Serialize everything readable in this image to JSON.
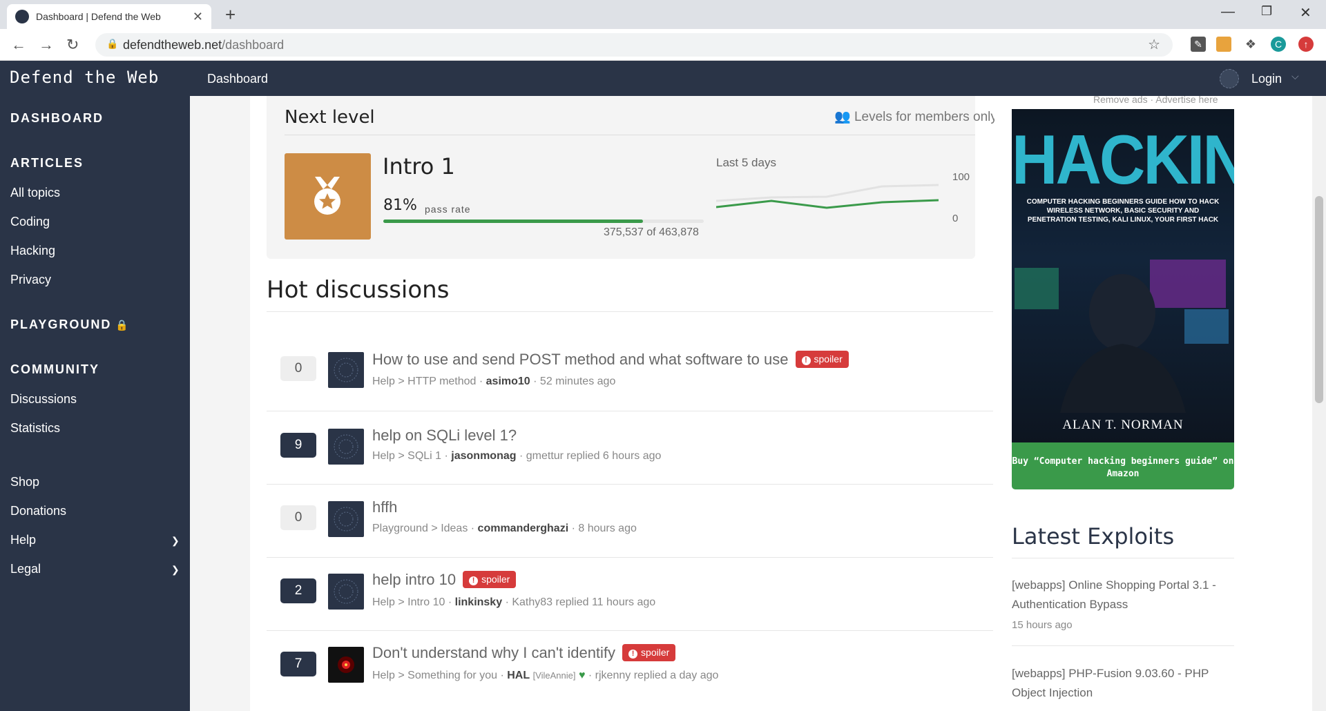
{
  "browser": {
    "tab_title": "Dashboard | Defend the Web",
    "url_host": "defendtheweb.net",
    "url_path": "/dashboard",
    "profile_initial": "C"
  },
  "header": {
    "logo": "Defend the Web",
    "nav_dashboard": "Dashboard",
    "login": "Login"
  },
  "sidebar": {
    "dashboard": "DASHBOARD",
    "articles": "ARTICLES",
    "article_items": [
      "All topics",
      "Coding",
      "Hacking",
      "Privacy"
    ],
    "playground": "PLAYGROUND",
    "community": "COMMUNITY",
    "community_items": [
      "Discussions",
      "Statistics"
    ],
    "shop": "Shop",
    "donations": "Donations",
    "help": "Help",
    "legal": "Legal"
  },
  "next_level": {
    "heading": "Next level",
    "members_note": "Levels for members only",
    "level_name": "Intro 1",
    "pass_percent": "81%",
    "pass_rate_label": "pass rate",
    "pass_fraction": 0.81,
    "count_text": "375,537 of 463,878",
    "chart_label": "Last 5 days",
    "chart_max": "100",
    "chart_min": "0"
  },
  "hot_discussions": {
    "heading": "Hot discussions",
    "items": [
      {
        "count": "0",
        "title": "How to use and send POST method and what software to use",
        "spoiler": true,
        "category": "Help",
        "topic": "HTTP method",
        "author": "asimo10",
        "tail": "· 52 minutes ago",
        "avatar": "default"
      },
      {
        "count": "9",
        "title": "help on SQLi level 1?",
        "spoiler": false,
        "category": "Help",
        "topic": "SQLi 1",
        "author": "jasonmonag",
        "tail": "· gmettur replied 6 hours ago",
        "avatar": "default"
      },
      {
        "count": "0",
        "title": "hffh",
        "spoiler": false,
        "category": "Playground",
        "topic": "Ideas",
        "author": "commanderghazi",
        "tail": "· 8 hours ago",
        "avatar": "default"
      },
      {
        "count": "2",
        "title": "help intro 10",
        "spoiler": true,
        "category": "Help",
        "topic": "Intro 10",
        "author": "linkinsky",
        "tail": "· Kathy83 replied 11 hours ago",
        "avatar": "default"
      },
      {
        "count": "7",
        "title": "Don't understand why I can't identify",
        "spoiler": true,
        "category": "Help",
        "topic": "Something for you",
        "author": "HAL",
        "author_tag": "[VileAnnie]",
        "tail": "· rjkenny replied a day ago",
        "avatar": "hal"
      }
    ],
    "spoiler_label": "spoiler"
  },
  "ad": {
    "links": "Remove ads · Advertise here",
    "book_title": "HACKING",
    "book_subtitle": "COMPUTER HACKING BEGINNERS GUIDE HOW TO HACK WIRELESS NETWORK, BASIC SECURITY AND PENETRATION TESTING, KALI LINUX, YOUR FIRST HACK",
    "book_author": "ALAN T. NORMAN",
    "buy_text": "Buy “Computer hacking beginners guide” on Amazon"
  },
  "latest_exploits": {
    "heading": "Latest Exploits",
    "items": [
      {
        "title": "[webapps] Online Shopping Portal 3.1 - Authentication Bypass",
        "time": "15 hours ago"
      },
      {
        "title": "[webapps] PHP-Fusion 9.03.60 - PHP Object Injection",
        "time": ""
      }
    ]
  },
  "colors": {
    "nav_bg": "#2a3447",
    "medal": "#cd8c45",
    "progress": "#3a9a4a",
    "spoiler": "#d63b3b",
    "buy_button": "#3a9a4a"
  }
}
